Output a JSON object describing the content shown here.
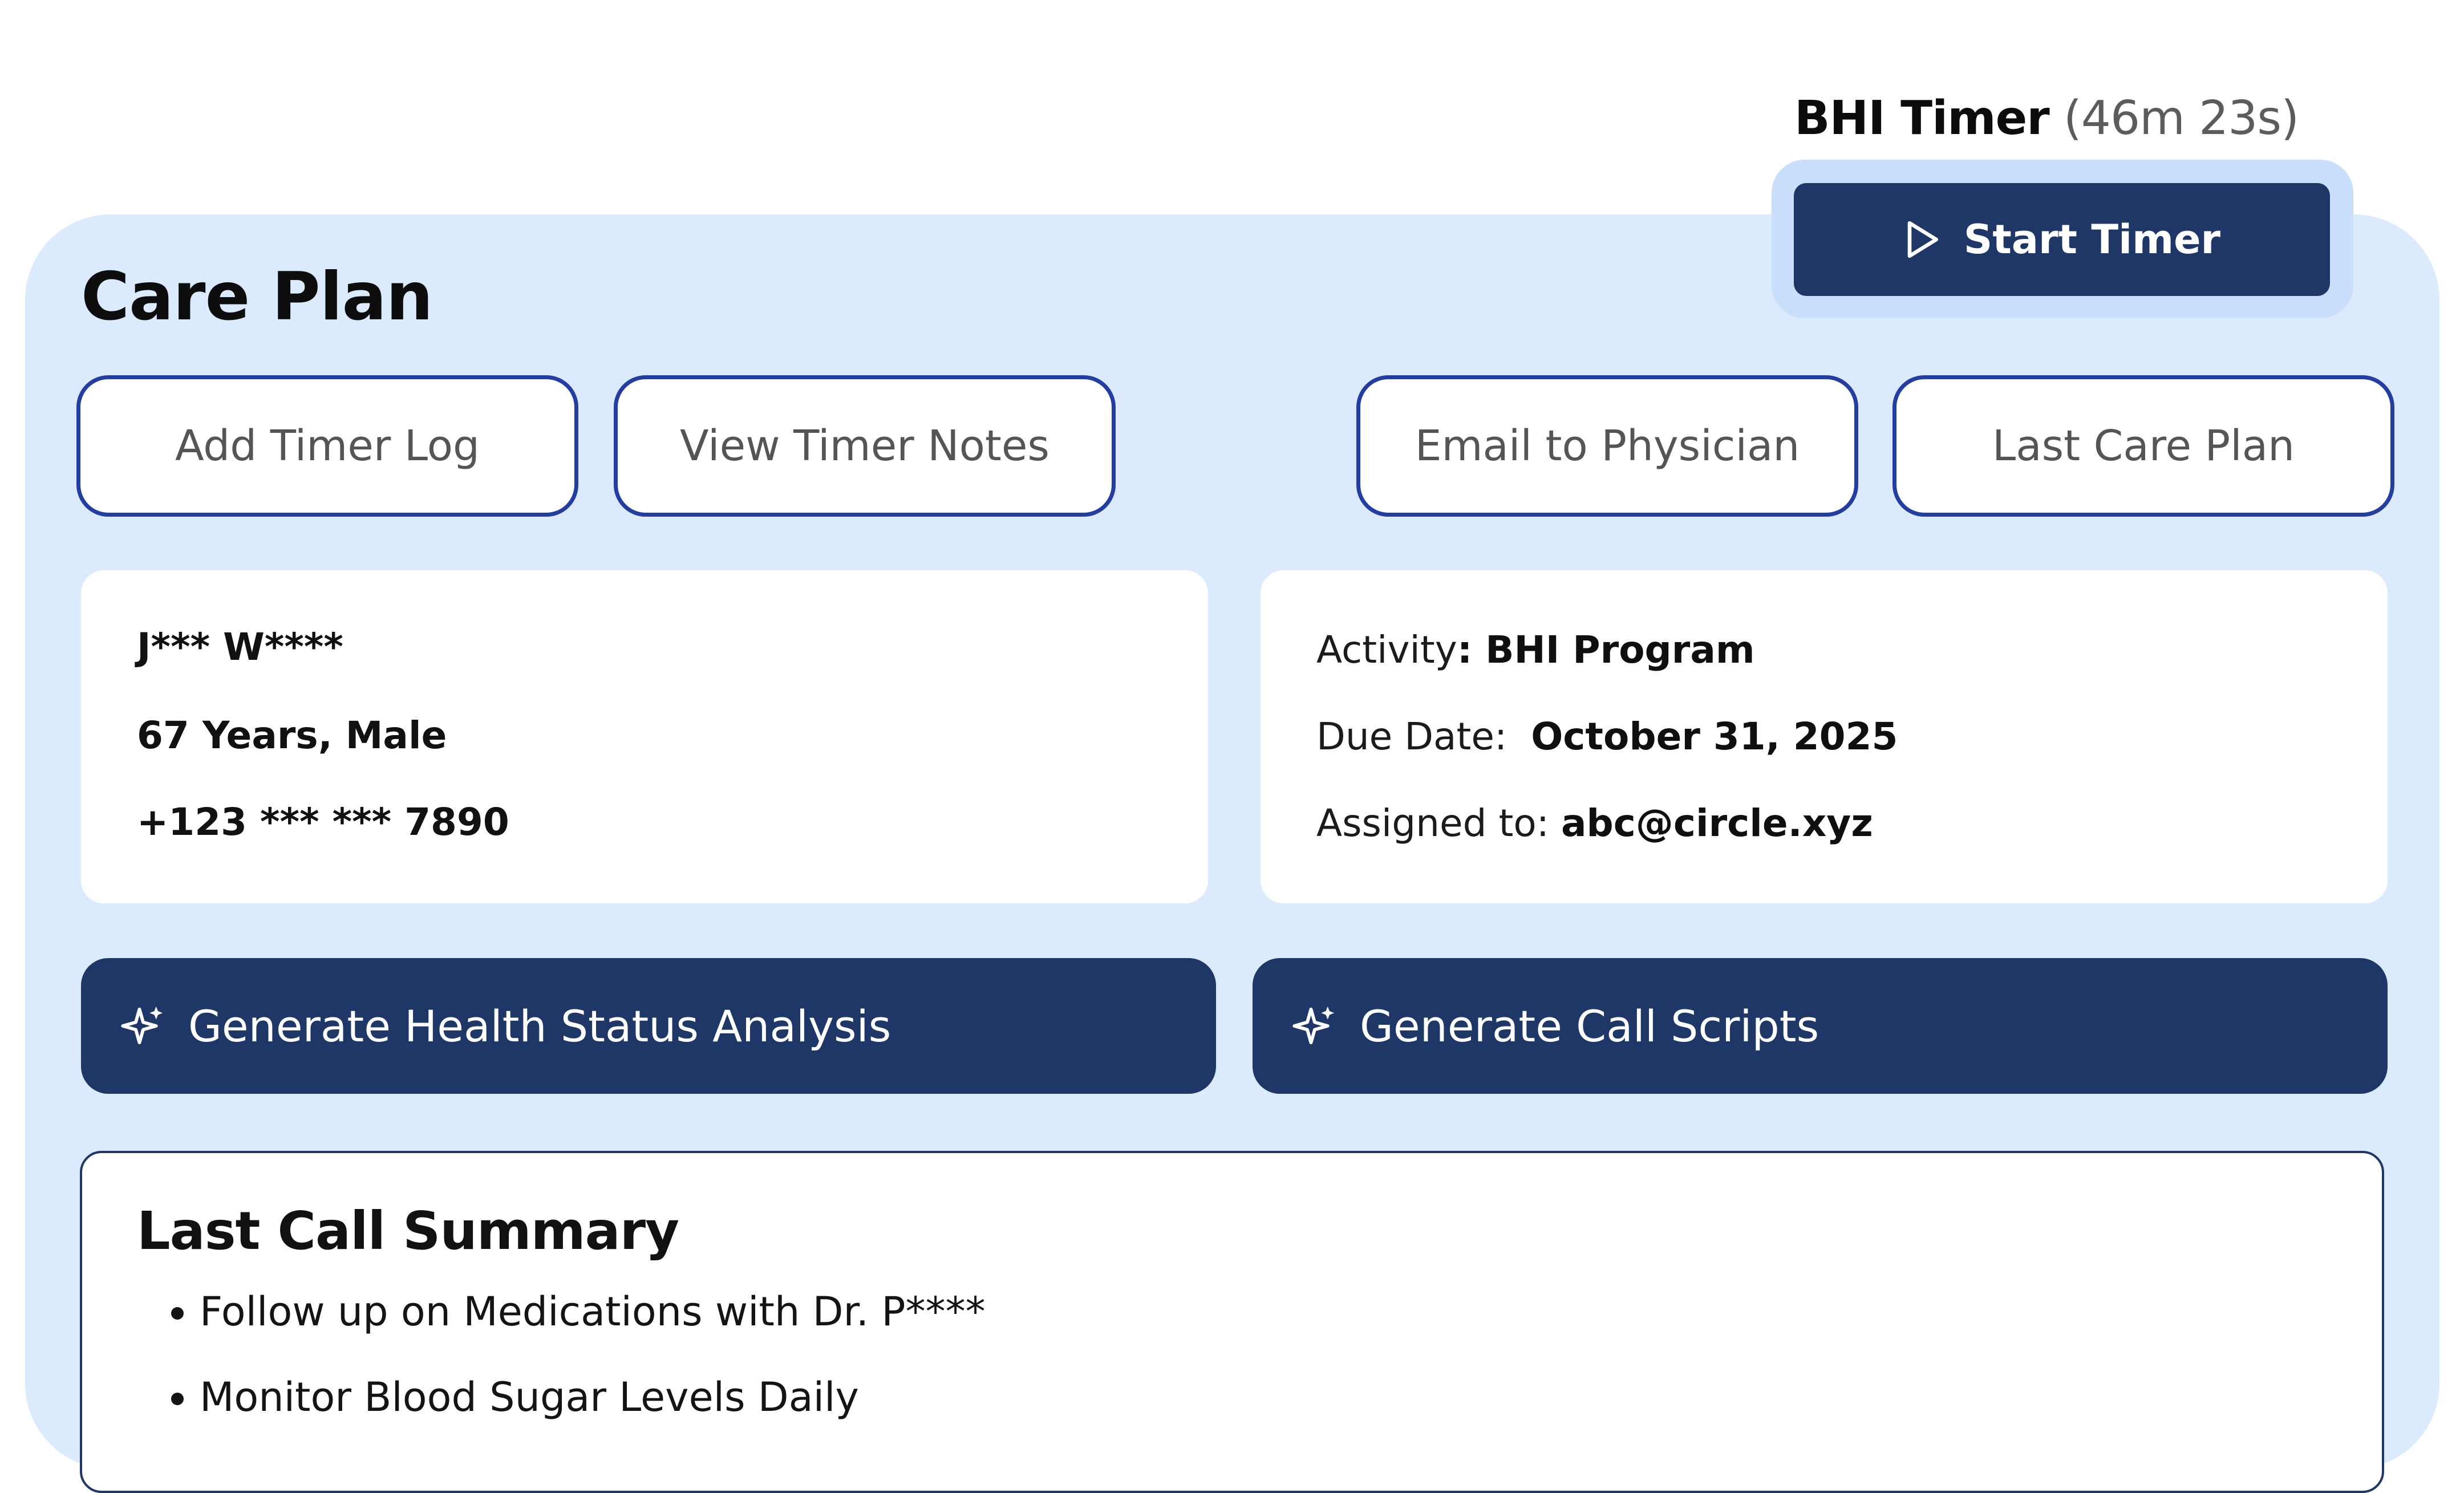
{
  "timer": {
    "name": "BHI Timer",
    "elapsed": "(46m 23s)",
    "start_label": "Start Timer"
  },
  "page": {
    "title": "Care Plan"
  },
  "actions": {
    "add_timer_log": "Add Timer Log",
    "view_timer_notes": "View Timer Notes",
    "email_physician": "Email to Physician",
    "last_care_plan": "Last Care Plan"
  },
  "patient": {
    "name": "J*** W****",
    "age_sex": "67 Years, Male",
    "phone": "+123 *** *** 7890"
  },
  "activity": {
    "activity_label": "Activity",
    "activity_value": "BHI Program",
    "due_label": "Due Date:",
    "due_value": "October 31, 2025",
    "assigned_label": "Assigned to:",
    "assigned_value": "abc@circle.xyz"
  },
  "generate": {
    "health_status": "Generate Health Status Analysis",
    "call_scripts": "Generate Call Scripts"
  },
  "summary": {
    "title": "Last Call Summary",
    "items": [
      "Follow up on Medications with Dr. P****",
      "Monitor Blood Sugar Levels Daily"
    ]
  },
  "colors": {
    "panel_bg": "#dceafd",
    "primary": "#1e3767",
    "outline_border": "#233ea0"
  },
  "icons": {
    "start_timer": "play-icon",
    "generate": "sparkles-icon"
  }
}
